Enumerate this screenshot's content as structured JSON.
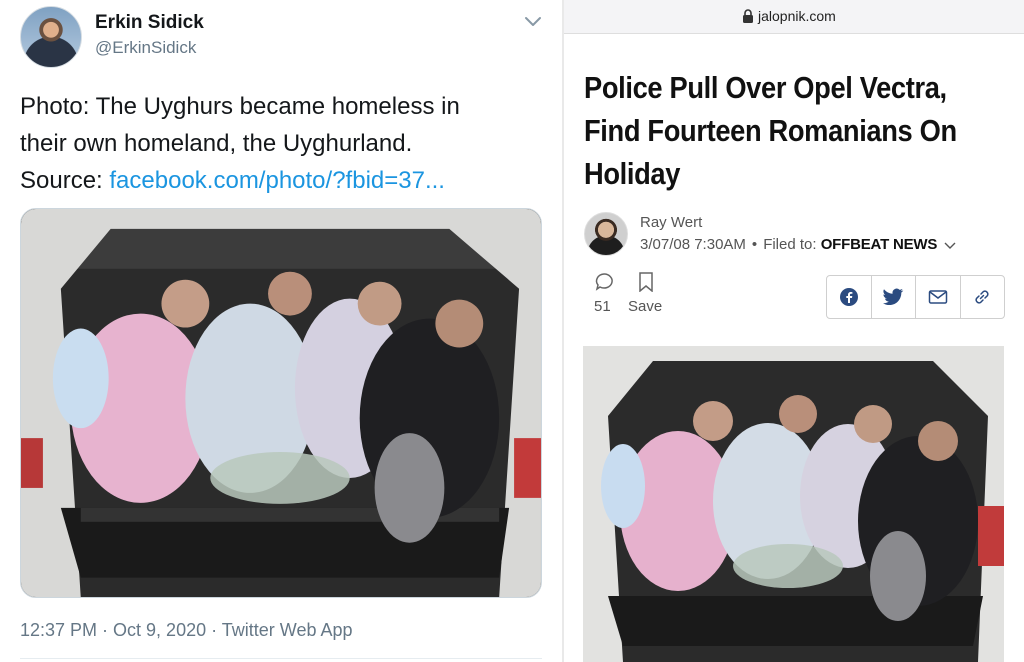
{
  "tweet": {
    "author_name": "Erkin Sidick",
    "author_handle": "@ErkinSidick",
    "text_line_1": "Photo: The Uyghurs became homeless in",
    "text_line_2": "their own homeland, the Uyghurland.",
    "text_source_prefix": "Source: ",
    "text_source_link": "facebook.com/photo/?fbid=37...",
    "timestamp": "12:37 PM · Oct 9, 2020 · Twitter Web App",
    "menu_icon": "chevron-down-icon",
    "colors": {
      "link": "#1b95e0",
      "text": "#14171a",
      "secondary": "#657786"
    }
  },
  "article": {
    "url": "jalopnik.com",
    "headline": "Police Pull Over Opel Vectra, Find Fourteen Romanians On Holiday",
    "author": "Ray Wert",
    "date": "3/07/08 7:30AM",
    "separator": "•",
    "filed_label": "Filed to: ",
    "filed_value": "OFFBEAT NEWS",
    "comment_count": "51",
    "save_label": "Save",
    "share_icons": [
      "facebook-icon",
      "twitter-icon",
      "email-icon",
      "link-icon"
    ],
    "colors": {
      "headline": "#111111",
      "meta": "#555555",
      "share_icon": "#2b4b80"
    }
  }
}
